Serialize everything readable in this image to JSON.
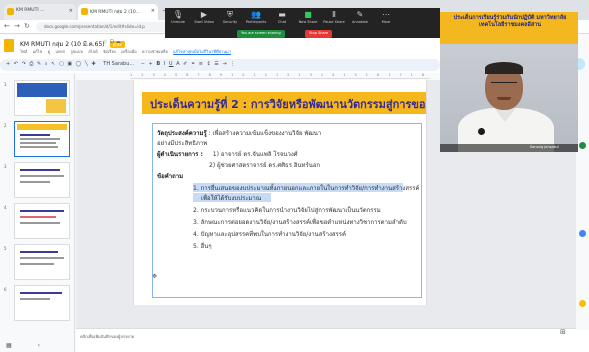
{
  "colors": {
    "slide_band": "#f5b81c",
    "slide_title": "#3a2a8c",
    "accent_blue": "#1a73e8",
    "zoom_bar": "#232323",
    "recording": "#e53935",
    "share": "#1e8e3e",
    "edit_badge": "#fbbc04"
  },
  "browser": {
    "tabs": [
      {
        "title": "KM RMUTI ...",
        "icon": "slides-icon"
      },
      {
        "title": "KM RMUTI กลุ่ม 2 (10...",
        "icon": "slides-icon"
      }
    ],
    "address": "docs.google.com/presentation/d/1/edit#slide=id.p"
  },
  "zoom_toolbar": {
    "items": [
      {
        "label": "Unmute",
        "icon": "microphone-icon"
      },
      {
        "label": "Start Video",
        "icon": "video-camera-icon"
      },
      {
        "label": "Security",
        "icon": "shield-icon"
      },
      {
        "label": "Participants",
        "icon": "participants-icon"
      },
      {
        "label": "Chat",
        "icon": "chat-icon"
      },
      {
        "label": "New Share",
        "icon": "share-screen-icon"
      },
      {
        "label": "Pause Share",
        "icon": "pause-icon"
      },
      {
        "label": "Annotate",
        "icon": "pen-icon"
      },
      {
        "label": "More",
        "icon": "more-icon"
      }
    ],
    "status_sharing": "You are screen sharing",
    "status_stop": "Stop Share"
  },
  "docs": {
    "title": "KM RMUTI กลุ่ม 2 (10 มี.ค.65)",
    "badge": "pptx",
    "menus": [
      "ไฟล์",
      "แก้ไข",
      "ดู",
      "แทรก",
      "รูปแบบ",
      "สไลด์",
      "จัดเรียง",
      "เครื่องมือ",
      "ความช่วยเหลือ"
    ],
    "last_edit": "แก้ไขล่าสุดเมื่อไม่กี่วินาทีที่ผ่านมา",
    "font": "TH Sarabu...",
    "edit_pill": "✎"
  },
  "slide": {
    "title": "ประเด็นความรู้ที่ 2 : การวิจัยหรือพัฒนานวัตกรรมสู่การขอ",
    "objective_label": "วัตถุประสงค์ความรู้",
    "objective_text": ": เพื่อสร้างความเข้มแข็งของงานวิจัย พัฒนา",
    "objective_cont": "อย่างมีประสิทธิภาพ",
    "operator_label": "ผู้ดำเนินรายการ :",
    "operator_1": "1) อาจารย์ ดร.จันแพลิ         โรจนวงศ์",
    "operator_2": "2) ผู้ช่วยศาสตราจารย์ ดร.ศศิธร     อินทร์นอก",
    "questions_label": "ข้อคำถาม",
    "questions": [
      "1. การยื่นเสนอของบประมาณทั้งภายนอกและภายในในการทำวิจัย/การทำงานสร้างสรรค์",
      "เพื่อให้ได้รับงบประมาณ",
      "2. กระบวนการหรือแนวคิดในการนำงานวิจัยไปสู่การพัฒนาเป็นนวัตกรรม",
      "3. ลักษณะการต่อยอดงานวิจัย/งานสร้างสรรค์เพื่อขอตำแหน่งทางวิชาการตามลำดับ",
      "4. ปัญหาและอุปสรรคที่พบในการทำงานวิจัย/งานสร้างสรรค์",
      "5. อื่นๆ"
    ]
  },
  "notes": {
    "placeholder": "คลิกเพื่อเพิ่มบันทึกของผู้บรรยาย"
  },
  "thumbnails": [
    "1",
    "2",
    "3",
    "4",
    "5",
    "6"
  ],
  "webcam": {
    "banner": "ประเด็นการเรียนรู้ร่วมกันนักปฏิบัติ มหาวิทยาลัยเทคโนโลยีราชมงคลอีสาน",
    "name": "Sanong Jansakul"
  }
}
